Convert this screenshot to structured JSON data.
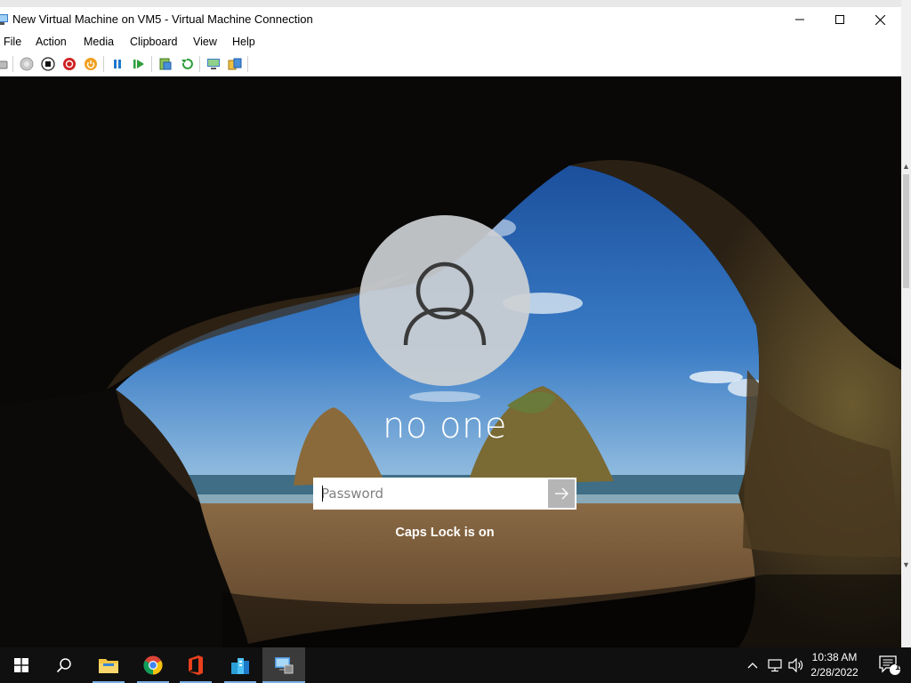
{
  "window": {
    "title": "New Virtual Machine on VM5 - Virtual Machine Connection",
    "controls": {
      "minimize": "minimize",
      "maximize": "maximize",
      "close": "close"
    }
  },
  "menu": {
    "items": [
      {
        "label": "File"
      },
      {
        "label": "Action"
      },
      {
        "label": "Media"
      },
      {
        "label": "Clipboard"
      },
      {
        "label": "View"
      },
      {
        "label": "Help"
      }
    ]
  },
  "toolbar": {
    "icons": [
      "ctrl-alt-del-icon",
      "start-icon",
      "turn-off-icon",
      "shut-down-icon",
      "power-icon",
      "pause-icon",
      "resume-icon",
      "checkpoint-icon",
      "revert-icon",
      "enhanced-session-icon",
      "share-icon"
    ],
    "colors": {
      "green": "#2e9e3a",
      "red": "#d02020",
      "orange": "#f0a020",
      "blue": "#1e78c8"
    }
  },
  "lockscreen": {
    "username": "no one",
    "password": {
      "placeholder": "Password",
      "value": ""
    },
    "caps_message": "Caps Lock is on"
  },
  "taskbar": {
    "items": [
      "start-icon",
      "search-icon",
      "file-explorer-icon",
      "chrome-icon",
      "office-icon",
      "server-manager-icon",
      "vm-connection-icon"
    ],
    "active": "vm-connection-icon",
    "accent": "#7ab0e6",
    "tray": [
      "chevron-up-icon",
      "network-icon",
      "volume-icon"
    ],
    "clock": {
      "time": "10:38 AM",
      "date": "2/28/2022"
    },
    "notifications": {
      "count": "1"
    }
  }
}
